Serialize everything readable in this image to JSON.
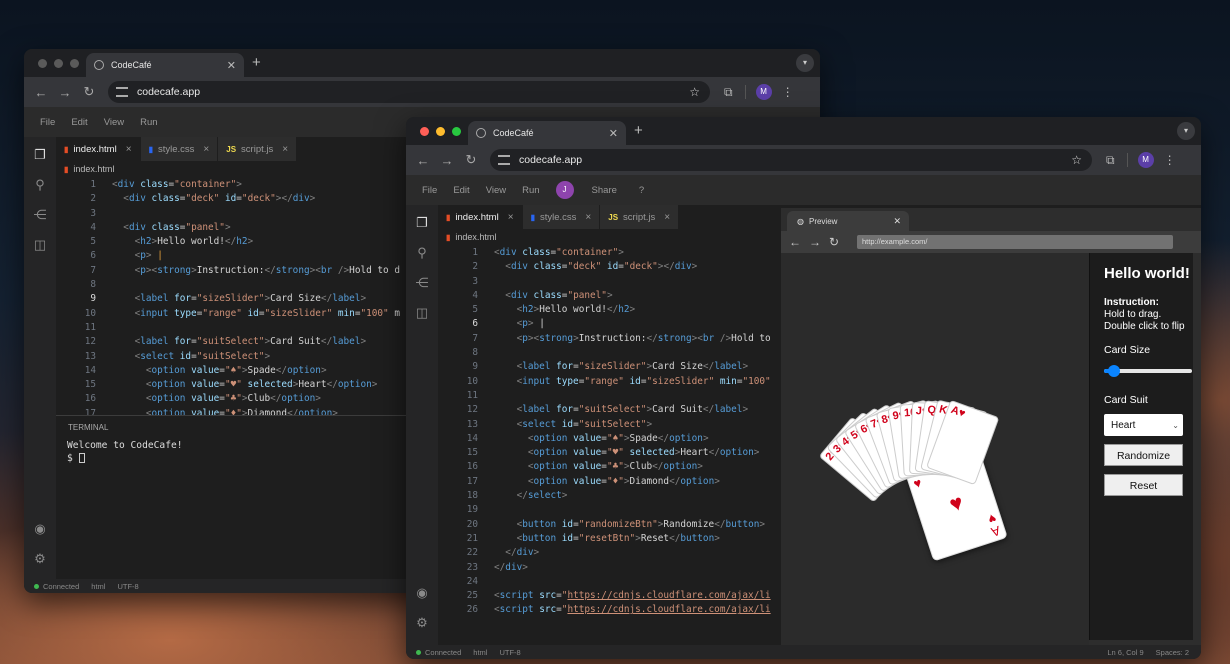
{
  "back_window": {
    "tab_title": "CodeCafé",
    "url": "codecafe.app",
    "profile_initial": "M",
    "menu": [
      "File",
      "Edit",
      "View",
      "Run"
    ],
    "file_tabs": [
      {
        "icon": "html",
        "label": "index.html",
        "active": true
      },
      {
        "icon": "css",
        "label": "style.css",
        "active": false
      },
      {
        "icon": "js",
        "label": "script.js",
        "active": false
      }
    ],
    "breadcrumb": "index.html",
    "code_lines": [
      {
        "n": "1",
        "html": "<span class='p'>&lt;</span><span class='t'>div</span> <span class='a'>class</span>=<span class='s'>\"container\"</span><span class='p'>&gt;</span>"
      },
      {
        "n": "2",
        "html": "  <span class='p'>&lt;</span><span class='t'>div</span> <span class='a'>class</span>=<span class='s'>\"deck\"</span> <span class='a'>id</span>=<span class='s'>\"deck\"</span><span class='p'>&gt;&lt;/</span><span class='t'>div</span><span class='p'>&gt;</span>"
      },
      {
        "n": "3",
        "html": ""
      },
      {
        "n": "4",
        "html": "  <span class='p'>&lt;</span><span class='t'>div</span> <span class='a'>class</span>=<span class='s'>\"panel\"</span><span class='p'>&gt;</span>"
      },
      {
        "n": "5",
        "html": "    <span class='p'>&lt;</span><span class='t'>h2</span><span class='p'>&gt;</span>Hello world!<span class='p'>&lt;/</span><span class='t'>h2</span><span class='p'>&gt;</span>"
      },
      {
        "n": "6",
        "html": "    <span class='p'>&lt;</span><span class='t'>p</span><span class='p'>&gt;</span> <span style='color:#e8a33b'>|</span>"
      },
      {
        "n": "7",
        "html": "    <span class='p'>&lt;</span><span class='t'>p</span><span class='p'>&gt;&lt;</span><span class='t'>strong</span><span class='p'>&gt;</span>Instruction:<span class='p'>&lt;/</span><span class='t'>strong</span><span class='p'>&gt;&lt;</span><span class='t'>br</span> <span class='p'>/&gt;</span>Hold to d"
      },
      {
        "n": "8",
        "html": ""
      },
      {
        "n": "9",
        "html": "    <span class='p'>&lt;</span><span class='t'>label</span> <span class='a'>for</span>=<span class='s'>\"sizeSlider\"</span><span class='p'>&gt;</span>Card Size<span class='p'>&lt;/</span><span class='t'>label</span><span class='p'>&gt;</span>",
        "cur": true
      },
      {
        "n": "10",
        "html": "    <span class='p'>&lt;</span><span class='t'>input</span> <span class='a'>type</span>=<span class='s'>\"range\"</span> <span class='a'>id</span>=<span class='s'>\"sizeSlider\"</span> <span class='a'>min</span>=<span class='s'>\"100\"</span> m"
      },
      {
        "n": "11",
        "html": ""
      },
      {
        "n": "12",
        "html": "    <span class='p'>&lt;</span><span class='t'>label</span> <span class='a'>for</span>=<span class='s'>\"suitSelect\"</span><span class='p'>&gt;</span>Card Suit<span class='p'>&lt;/</span><span class='t'>label</span><span class='p'>&gt;</span>"
      },
      {
        "n": "13",
        "html": "    <span class='p'>&lt;</span><span class='t'>select</span> <span class='a'>id</span>=<span class='s'>\"suitSelect\"</span><span class='p'>&gt;</span>"
      },
      {
        "n": "14",
        "html": "      <span class='p'>&lt;</span><span class='t'>option</span> <span class='a'>value</span>=<span class='s'>\"♠\"</span><span class='p'>&gt;</span>Spade<span class='p'>&lt;/</span><span class='t'>option</span><span class='p'>&gt;</span>"
      },
      {
        "n": "15",
        "html": "      <span class='p'>&lt;</span><span class='t'>option</span> <span class='a'>value</span>=<span class='s'>\"♥\"</span> <span class='a'>selected</span><span class='p'>&gt;</span>Heart<span class='p'>&lt;/</span><span class='t'>option</span><span class='p'>&gt;</span>"
      },
      {
        "n": "16",
        "html": "      <span class='p'>&lt;</span><span class='t'>option</span> <span class='a'>value</span>=<span class='s'>\"♣\"</span><span class='p'>&gt;</span>Club<span class='p'>&lt;/</span><span class='t'>option</span><span class='p'>&gt;</span>"
      },
      {
        "n": "17",
        "html": "      <span class='p'>&lt;</span><span class='t'>option</span> <span class='a'>value</span>=<span class='s'>\"♦\"</span><span class='p'>&gt;</span>Diamond<span class='p'>&lt;/</span><span class='t'>option</span><span class='p'>&gt;</span>"
      }
    ],
    "terminal_label": "TERMINAL",
    "terminal_welcome": "Welcome to CodeCafe!",
    "terminal_prompt": "$",
    "status": {
      "connected": "Connected",
      "lang": "html",
      "enc": "UTF-8"
    }
  },
  "front_window": {
    "tab_title": "CodeCafé",
    "url": "codecafe.app",
    "profile_initial": "M",
    "menu": [
      "File",
      "Edit",
      "View",
      "Run"
    ],
    "user_initial": "J",
    "share_label": "Share",
    "help_label": "?",
    "file_tabs": [
      {
        "icon": "html",
        "label": "index.html",
        "active": true
      },
      {
        "icon": "css",
        "label": "style.css",
        "active": false
      },
      {
        "icon": "js",
        "label": "script.js",
        "active": false
      }
    ],
    "breadcrumb": "index.html",
    "code_lines": [
      {
        "n": "1",
        "html": "<span class='p'>&lt;</span><span class='t'>div</span> <span class='a'>class</span>=<span class='s'>\"container\"</span><span class='p'>&gt;</span>"
      },
      {
        "n": "2",
        "html": "  <span class='p'>&lt;</span><span class='t'>div</span> <span class='a'>class</span>=<span class='s'>\"deck\"</span> <span class='a'>id</span>=<span class='s'>\"deck\"</span><span class='p'>&gt;&lt;/</span><span class='t'>div</span><span class='p'>&gt;</span>"
      },
      {
        "n": "3",
        "html": ""
      },
      {
        "n": "4",
        "html": "  <span class='p'>&lt;</span><span class='t'>div</span> <span class='a'>class</span>=<span class='s'>\"panel\"</span><span class='p'>&gt;</span>"
      },
      {
        "n": "5",
        "html": "    <span class='p'>&lt;</span><span class='t'>h2</span><span class='p'>&gt;</span>Hello world!<span class='p'>&lt;/</span><span class='t'>h2</span><span class='p'>&gt;</span>"
      },
      {
        "n": "6",
        "html": "    <span class='p'>&lt;</span><span class='t'>p</span><span class='p'>&gt;</span> <span style='color:#ddd'>|</span>",
        "cur": true
      },
      {
        "n": "7",
        "html": "    <span class='p'>&lt;</span><span class='t'>p</span><span class='p'>&gt;&lt;</span><span class='t'>strong</span><span class='p'>&gt;</span>Instruction:<span class='p'>&lt;/</span><span class='t'>strong</span><span class='p'>&gt;&lt;</span><span class='t'>br</span> <span class='p'>/&gt;</span>Hold to"
      },
      {
        "n": "8",
        "html": ""
      },
      {
        "n": "9",
        "html": "    <span class='p'>&lt;</span><span class='t'>label</span> <span class='a'>for</span>=<span class='s'>\"sizeSlider\"</span><span class='p'>&gt;</span>Card Size<span class='p'>&lt;/</span><span class='t'>label</span><span class='p'>&gt;</span>"
      },
      {
        "n": "10",
        "html": "    <span class='p'>&lt;</span><span class='t'>input</span> <span class='a'>type</span>=<span class='s'>\"range\"</span> <span class='a'>id</span>=<span class='s'>\"sizeSlider\"</span> <span class='a'>min</span>=<span class='s'>\"100\"</span>"
      },
      {
        "n": "11",
        "html": ""
      },
      {
        "n": "12",
        "html": "    <span class='p'>&lt;</span><span class='t'>label</span> <span class='a'>for</span>=<span class='s'>\"suitSelect\"</span><span class='p'>&gt;</span>Card Suit<span class='p'>&lt;/</span><span class='t'>label</span><span class='p'>&gt;</span>"
      },
      {
        "n": "13",
        "html": "    <span class='p'>&lt;</span><span class='t'>select</span> <span class='a'>id</span>=<span class='s'>\"suitSelect\"</span><span class='p'>&gt;</span>"
      },
      {
        "n": "14",
        "html": "      <span class='p'>&lt;</span><span class='t'>option</span> <span class='a'>value</span>=<span class='s'>\"♠\"</span><span class='p'>&gt;</span>Spade<span class='p'>&lt;/</span><span class='t'>option</span><span class='p'>&gt;</span>"
      },
      {
        "n": "15",
        "html": "      <span class='p'>&lt;</span><span class='t'>option</span> <span class='a'>value</span>=<span class='s'>\"♥\"</span> <span class='a'>selected</span><span class='p'>&gt;</span>Heart<span class='p'>&lt;/</span><span class='t'>option</span><span class='p'>&gt;</span>"
      },
      {
        "n": "16",
        "html": "      <span class='p'>&lt;</span><span class='t'>option</span> <span class='a'>value</span>=<span class='s'>\"♣\"</span><span class='p'>&gt;</span>Club<span class='p'>&lt;/</span><span class='t'>option</span><span class='p'>&gt;</span>"
      },
      {
        "n": "17",
        "html": "      <span class='p'>&lt;</span><span class='t'>option</span> <span class='a'>value</span>=<span class='s'>\"♦\"</span><span class='p'>&gt;</span>Diamond<span class='p'>&lt;/</span><span class='t'>option</span><span class='p'>&gt;</span>"
      },
      {
        "n": "18",
        "html": "    <span class='p'>&lt;/</span><span class='t'>select</span><span class='p'>&gt;</span>"
      },
      {
        "n": "19",
        "html": ""
      },
      {
        "n": "20",
        "html": "    <span class='p'>&lt;</span><span class='t'>button</span> <span class='a'>id</span>=<span class='s'>\"randomizeBtn\"</span><span class='p'>&gt;</span>Randomize<span class='p'>&lt;/</span><span class='t'>button</span><span class='p'>&gt;</span>"
      },
      {
        "n": "21",
        "html": "    <span class='p'>&lt;</span><span class='t'>button</span> <span class='a'>id</span>=<span class='s'>\"resetBtn\"</span><span class='p'>&gt;</span>Reset<span class='p'>&lt;/</span><span class='t'>button</span><span class='p'>&gt;</span>"
      },
      {
        "n": "22",
        "html": "  <span class='p'>&lt;/</span><span class='t'>div</span><span class='p'>&gt;</span>"
      },
      {
        "n": "23",
        "html": "<span class='p'>&lt;/</span><span class='t'>div</span><span class='p'>&gt;</span>"
      },
      {
        "n": "24",
        "html": ""
      },
      {
        "n": "25",
        "html": "<span class='p'>&lt;</span><span class='t'>script</span> <span class='a'>src</span>=<span class='s'>\"<u>https://cdnjs.cloudflare.com/ajax/li</u></span>"
      },
      {
        "n": "26",
        "html": "<span class='p'>&lt;</span><span class='t'>script</span> <span class='a'>src</span>=<span class='s'>\"<u>https://cdnjs.cloudflare.com/ajax/li</u></span>"
      }
    ],
    "preview": {
      "tab_label": "Preview",
      "url": "http://example.com/",
      "heading": "Hello world!",
      "instruction_label": "Instruction:",
      "instruction_text": "Hold to drag. Double click to flip",
      "size_label": "Card Size",
      "size_value": 0.05,
      "suit_label": "Card Suit",
      "suit_selected": "Heart",
      "randomize_label": "Randomize",
      "reset_label": "Reset",
      "fan_ranks": [
        "2",
        "3",
        "4",
        "5",
        "6",
        "7",
        "8",
        "9",
        "10",
        "J",
        "Q",
        "K",
        "A"
      ],
      "top_card_rank": "A",
      "top_card_suit": "♥"
    },
    "status": {
      "connected": "Connected",
      "lang": "html",
      "enc": "UTF-8",
      "position": "Ln 6, Col 9",
      "spaces": "Spaces: 2"
    }
  }
}
